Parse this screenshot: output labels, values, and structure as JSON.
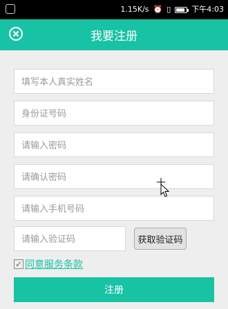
{
  "status_bar": {
    "speed": "1.15K/s",
    "time": "下午4:03"
  },
  "header": {
    "title": "我要注册"
  },
  "form": {
    "name_placeholder": "填写本人真实姓名",
    "id_placeholder": "身份证号码",
    "password_placeholder": "请输入密码",
    "confirm_placeholder": "请确认密码",
    "phone_placeholder": "请输入手机号码",
    "code_placeholder": "请输入验证码",
    "get_code_label": "获取验证码",
    "agree_checked": true,
    "agree_label": "同意服务条款",
    "submit_label": "注册"
  },
  "colors": {
    "accent": "#18c2a5"
  }
}
